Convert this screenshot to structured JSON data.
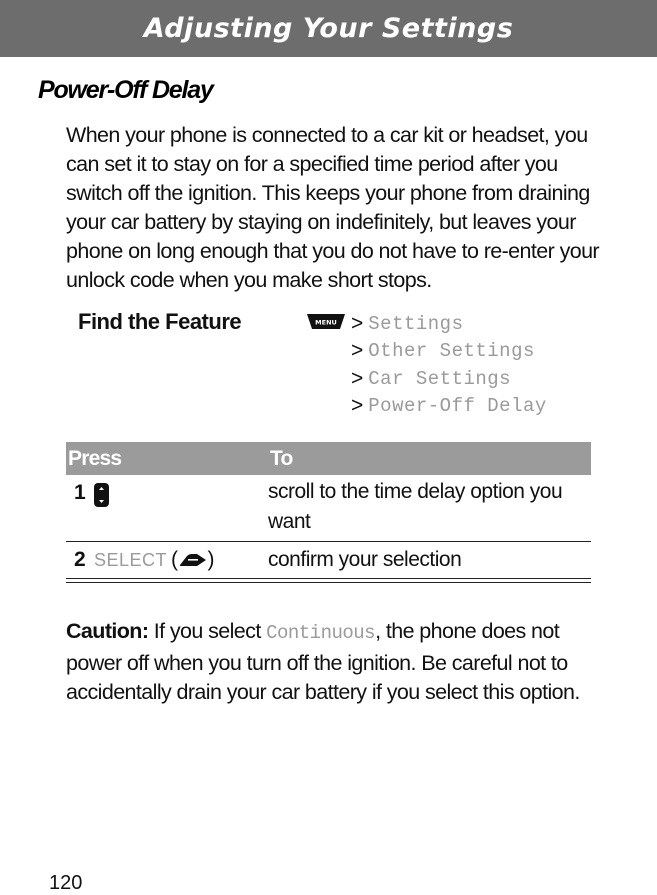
{
  "header": {
    "title": "Adjusting Your Settings",
    "background_color": "#6d6d6d"
  },
  "section": {
    "title": "Power-Off Delay",
    "intro": "When your phone is connected to a car kit or headset, you can set it to stay on for a specified time period after you switch off the ignition. This keeps your phone from draining your car battery by staying on indefinitely, but leaves your phone on long enough that you do not have to re-enter your unlock code when you make short stops."
  },
  "find_feature": {
    "label": "Find the Feature",
    "menu_key_icon": "menu-key-icon",
    "menu_key_text": "MENU",
    "separator": ">",
    "path": [
      "Settings",
      "Other Settings",
      "Car Settings",
      "Power-Off Delay"
    ]
  },
  "table": {
    "headers": {
      "press": "Press",
      "to": "To"
    },
    "header_color": "#9b9b9b",
    "rows": [
      {
        "step": "1",
        "press_icon": "scroll-nav-key-icon",
        "press_text": "",
        "to": "scroll to the time delay option you want"
      },
      {
        "step": "2",
        "press_icon": "select-soft-key-icon",
        "press_text": "SELECT",
        "to": "confirm your selection"
      }
    ]
  },
  "caution": {
    "label": "Caution:",
    "before": " If you select ",
    "option": "Continuous",
    "after": ", the phone does not power off when you turn off the ignition. Be careful not to accidentally drain your car battery if you select this option."
  },
  "footer": {
    "page_number": "120"
  }
}
